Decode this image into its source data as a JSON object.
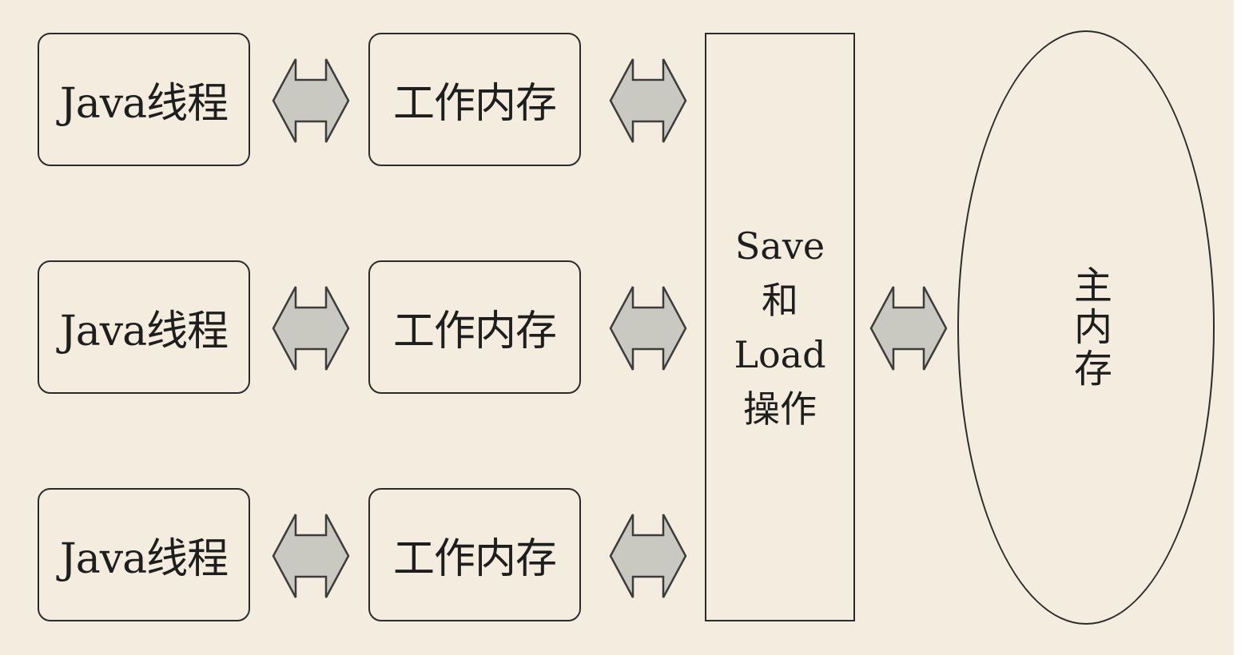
{
  "threads": [
    {
      "label": "Java线程"
    },
    {
      "label": "Java线程"
    },
    {
      "label": "Java线程"
    }
  ],
  "working_memories": [
    {
      "label": "工作内存"
    },
    {
      "label": "工作内存"
    },
    {
      "label": "工作内存"
    }
  ],
  "save_load": {
    "lines": [
      "Save",
      "和",
      "Load",
      "操作"
    ]
  },
  "main_memory": {
    "label": "主内存"
  },
  "colors": {
    "background": "#f4eddf",
    "border": "#2b2b2b",
    "arrow_fill": "#c9c9c2"
  }
}
